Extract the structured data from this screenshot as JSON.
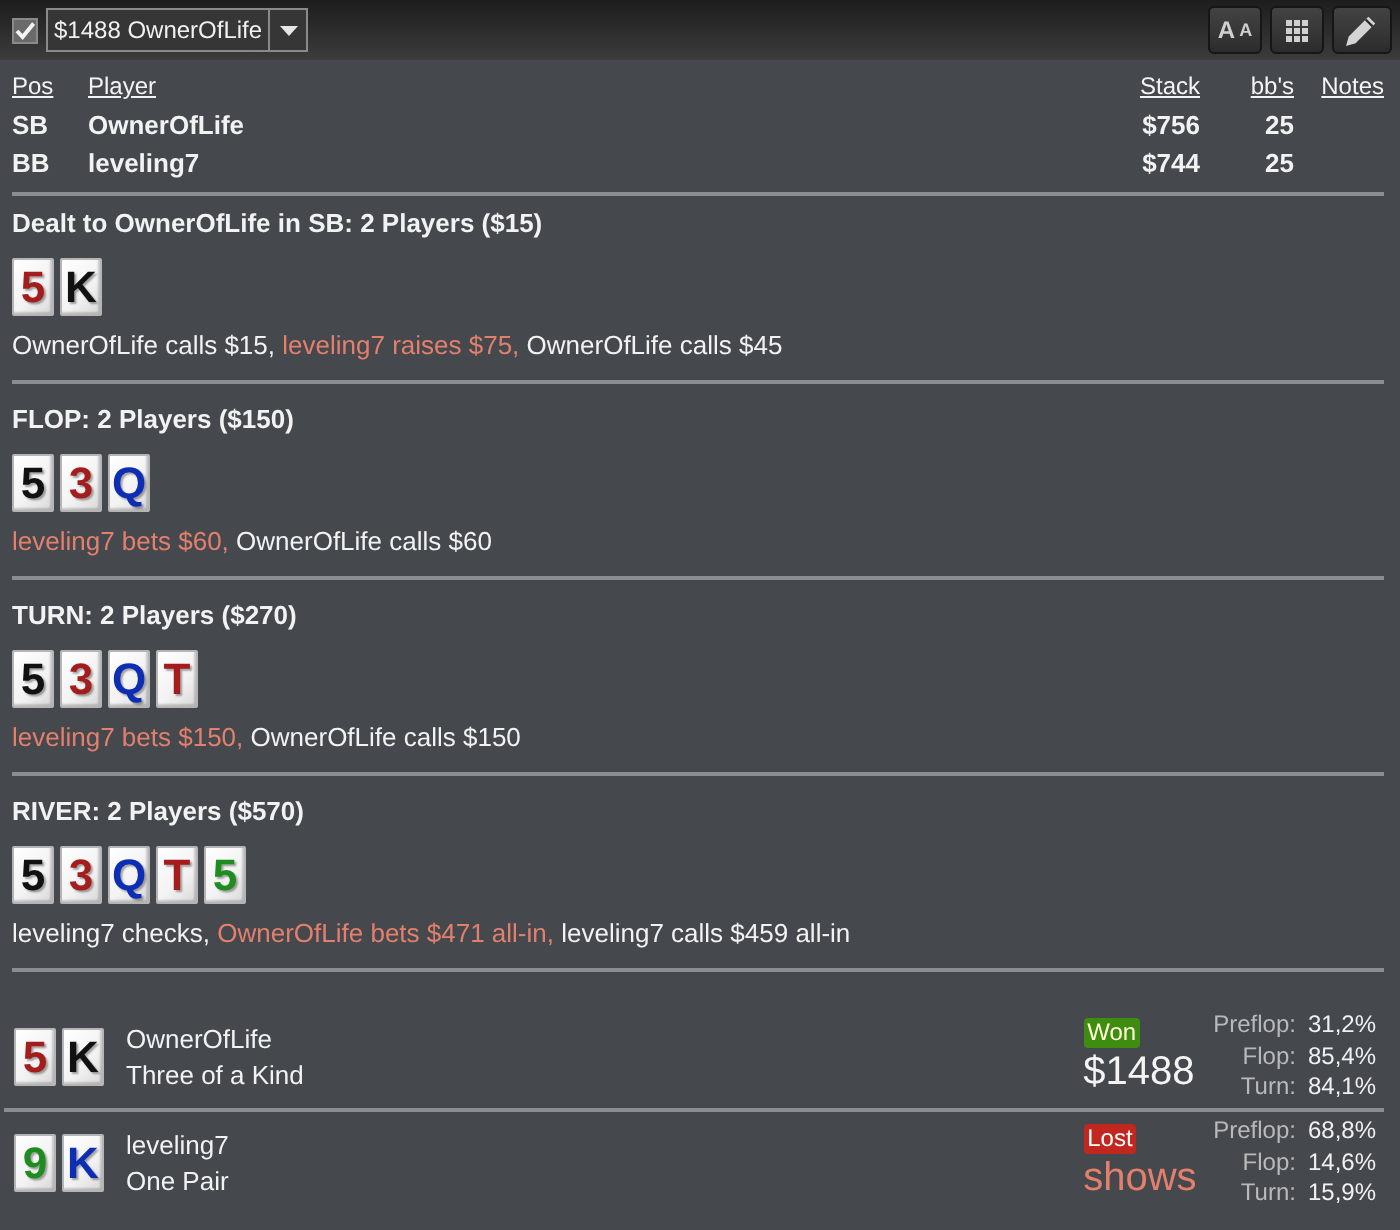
{
  "toolbar": {
    "checkbox": {
      "checked": true
    },
    "dropdown": {
      "value": "$1488 OwnerOfLife"
    },
    "buttons": [
      {
        "kind": "text-size",
        "letters": [
          "A",
          "A"
        ]
      },
      {
        "kind": "grid"
      },
      {
        "kind": "edit"
      }
    ]
  },
  "players": {
    "columns": [
      "Pos",
      "Player",
      "Stack",
      "bb's",
      "Notes"
    ],
    "rows": [
      {
        "pos": "SB",
        "player": "OwnerOfLife",
        "stack": "$756",
        "bbs": "25"
      },
      {
        "pos": "BB",
        "player": "leveling7",
        "stack": "$744",
        "bbs": "25"
      }
    ]
  },
  "streets": [
    {
      "title": "Dealt to OwnerOfLife in SB: 2 Players ($15)",
      "cards": [
        {
          "rank": "5",
          "color": "#a51c1c"
        },
        {
          "rank": "K",
          "color": "#111111"
        }
      ],
      "actions": [
        {
          "text": "OwnerOfLife calls $15,",
          "aggressive": false
        },
        {
          "text": "leveling7 raises $75,",
          "aggressive": true
        },
        {
          "text": "OwnerOfLife calls $45",
          "aggressive": false
        }
      ]
    },
    {
      "title": "FLOP: 2 Players ($150)",
      "cards": [
        {
          "rank": "5",
          "color": "#111111"
        },
        {
          "rank": "3",
          "color": "#a51c1c"
        },
        {
          "rank": "Q",
          "color": "#0d2db5"
        }
      ],
      "actions": [
        {
          "text": "leveling7 bets $60,",
          "aggressive": true
        },
        {
          "text": "OwnerOfLife calls $60",
          "aggressive": false
        }
      ]
    },
    {
      "title": "TURN: 2 Players ($270)",
      "cards": [
        {
          "rank": "5",
          "color": "#111111"
        },
        {
          "rank": "3",
          "color": "#a51c1c"
        },
        {
          "rank": "Q",
          "color": "#0d2db5"
        },
        {
          "rank": "T",
          "color": "#a51c1c"
        }
      ],
      "actions": [
        {
          "text": "leveling7 bets $150,",
          "aggressive": true
        },
        {
          "text": "OwnerOfLife calls $150",
          "aggressive": false
        }
      ]
    },
    {
      "title": "RIVER: 2 Players ($570)",
      "cards": [
        {
          "rank": "5",
          "color": "#111111"
        },
        {
          "rank": "3",
          "color": "#a51c1c"
        },
        {
          "rank": "Q",
          "color": "#0d2db5"
        },
        {
          "rank": "T",
          "color": "#a51c1c"
        },
        {
          "rank": "5",
          "color": "#1e8c1e"
        }
      ],
      "actions": [
        {
          "text": "leveling7 checks,",
          "aggressive": false
        },
        {
          "text": "OwnerOfLife bets $471 all-in,",
          "aggressive": true
        },
        {
          "text": "leveling7 calls $459 all-in",
          "aggressive": false
        }
      ]
    }
  ],
  "results": [
    {
      "cards": [
        {
          "rank": "5",
          "color": "#a51c1c"
        },
        {
          "rank": "K",
          "color": "#111111"
        }
      ],
      "player": "OwnerOfLife",
      "hand": "Three of a Kind",
      "outcome": {
        "kind": "won",
        "label": "Won"
      },
      "amount": "$1488",
      "equities": [
        {
          "street": "Preflop:",
          "value": "31,2%"
        },
        {
          "street": "Flop:",
          "value": "85,4%"
        },
        {
          "street": "Turn:",
          "value": "84,1%"
        }
      ]
    },
    {
      "cards": [
        {
          "rank": "9",
          "color": "#1e8c1e"
        },
        {
          "rank": "K",
          "color": "#0d2db5"
        }
      ],
      "player": "leveling7",
      "hand": "One Pair",
      "outcome": {
        "kind": "lost",
        "label": "Lost"
      },
      "amount": "shows",
      "equities": [
        {
          "street": "Preflop:",
          "value": "68,8%"
        },
        {
          "street": "Flop:",
          "value": "14,6%"
        },
        {
          "street": "Turn:",
          "value": "15,9%"
        }
      ]
    }
  ]
}
